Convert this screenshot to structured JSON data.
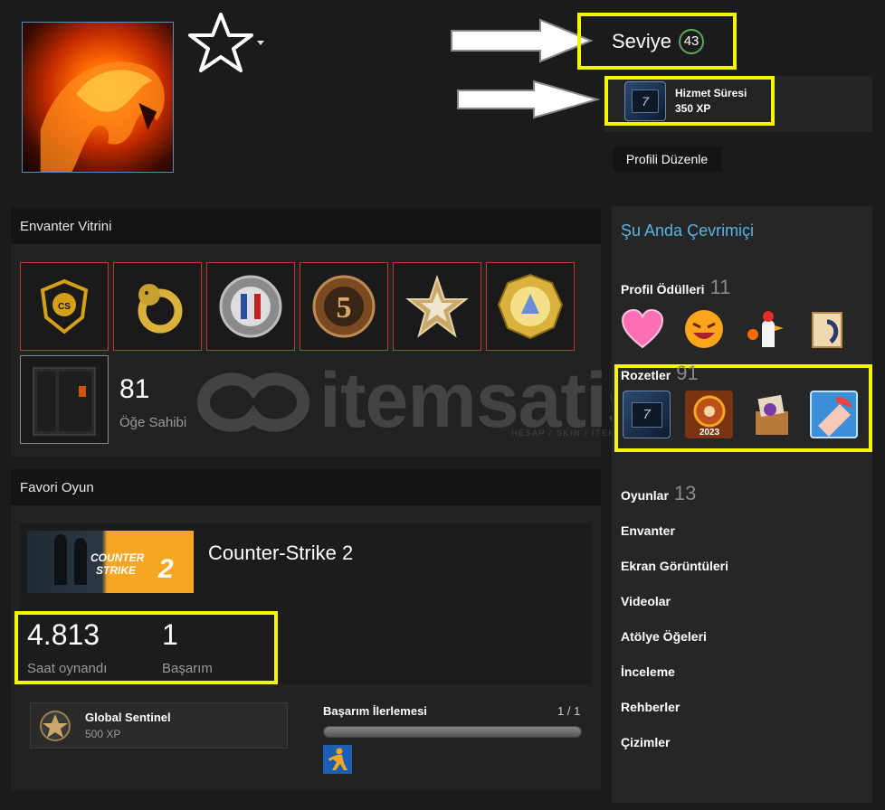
{
  "header": {
    "level_label": "Seviye",
    "level_value": "43",
    "service_badge_title": "Hizmet Süresi",
    "service_badge_xp": "350 XP",
    "service_badge_years": "7",
    "edit_profile": "Profili Düzenle"
  },
  "inventory": {
    "title": "Envanter Vitrini",
    "items": [
      "cs-go-badge",
      "golden-snake",
      "france-coin",
      "five-year-veteran",
      "star-badge",
      "gold-coin"
    ],
    "owned_count": "81",
    "owned_label": "Öğe Sahibi"
  },
  "watermark": {
    "text": "itemsatis",
    "sub": "HESAP / SKIN / ITEM / E-PIN .com"
  },
  "favorite": {
    "title": "Favori Oyun",
    "game_name": "Counter-Strike 2",
    "capsule_text_1": "COUNTER",
    "capsule_text_2": "STRIKE",
    "capsule_num": "2",
    "hours_value": "4.813",
    "hours_label": "Saat oynandı",
    "ach_value": "1",
    "ach_label": "Başarım",
    "badge_name": "Global Sentinel",
    "badge_xp": "500 XP",
    "progress_label": "Başarım İlerlemesi",
    "progress_count": "1 / 1",
    "progress_fraction": 1.0
  },
  "sidebar": {
    "online": "Şu Anda Çevrimiçi",
    "awards_label": "Profil Ödülleri",
    "awards_count": "11",
    "badges_label": "Rozetler",
    "badges_count": "91",
    "badge_2023_label": "2023",
    "games_label": "Oyunlar",
    "games_count": "13",
    "links": [
      "Envanter",
      "Ekran Görüntüleri",
      "Videolar",
      "Atölye Öğeleri",
      "İnceleme",
      "Rehberler",
      "Çizimler"
    ]
  },
  "colors": {
    "highlight": "#f5f500",
    "online": "#5ab3e8",
    "level_ring": "#5aa95a"
  }
}
